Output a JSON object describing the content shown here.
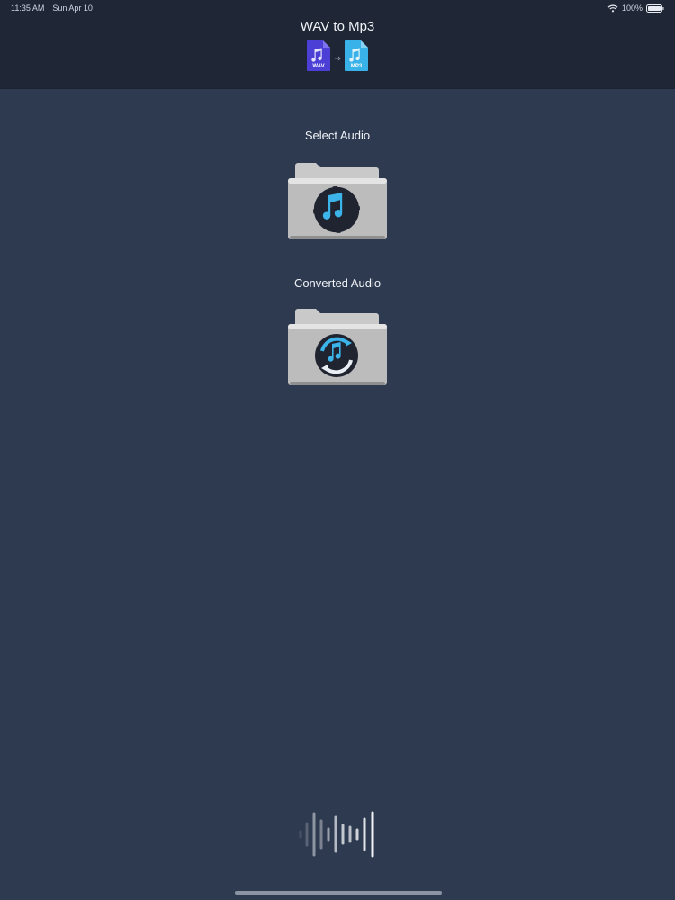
{
  "status_bar": {
    "time": "11:35 AM",
    "date": "Sun Apr 10",
    "battery": "100%",
    "wifi_icon": "wifi-icon",
    "battery_icon": "battery-icon"
  },
  "header": {
    "title": "WAV to Mp3",
    "source_badge": "WAV",
    "target_badge": "MP3",
    "source_color": "#4b3fd6",
    "target_color": "#38b2e8"
  },
  "sections": {
    "select_label": "Select Audio",
    "select_icon": "music-note-folder-icon",
    "converted_label": "Converted Audio",
    "converted_icon": "convert-music-folder-icon"
  },
  "footer": {
    "icon": "audio-waveform-icon"
  },
  "colors": {
    "background": "#2e3a4f",
    "header_background": "#1f2736",
    "accent": "#38b2e8"
  }
}
